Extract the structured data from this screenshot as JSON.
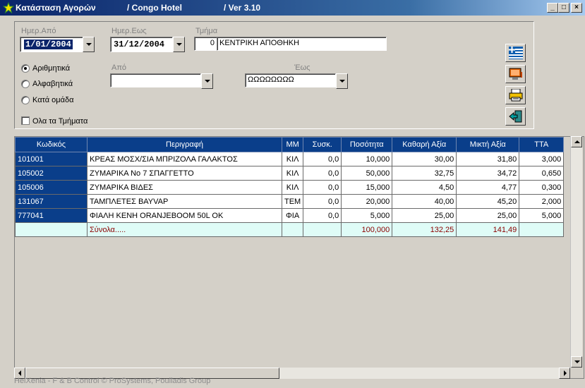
{
  "window": {
    "title": "Κατάσταση Αγορών",
    "hotel": "/ Congo Hotel",
    "version": "/ Ver  3.10",
    "minimize": "_",
    "maximize": "□",
    "close": "×"
  },
  "filters": {
    "date_from_label": "Ημερ.Από",
    "date_from_value": "1/01/2004",
    "date_to_label": "Ημερ.Εως",
    "date_to_value": "31/12/2004",
    "department_label": "Τμήμα",
    "department_code": "0",
    "department_name": "ΚΕΝΤΡΙΚΗ ΑΠΟΘΗΚΗ",
    "from_label": "Από",
    "from_value": "",
    "to_label": "Έως",
    "to_value": "ΩΩΩΩΩΩΩΩ"
  },
  "sort_options": [
    {
      "label": "Αριθμητικά",
      "selected": true
    },
    {
      "label": "Αλφαβητικά",
      "selected": false
    },
    {
      "label": "Κατά ομάδα",
      "selected": false
    }
  ],
  "all_departments": {
    "label": "Ολα τα Τμήματα",
    "checked": false
  },
  "toolbar": [
    {
      "name": "language-flag",
      "icon": "greek-flag-icon"
    },
    {
      "name": "screen-preview",
      "icon": "monitor-icon"
    },
    {
      "name": "print",
      "icon": "printer-icon"
    },
    {
      "name": "exit",
      "icon": "exit-door-icon"
    }
  ],
  "table": {
    "columns": [
      "Κωδικός",
      "Περιγραφή",
      "ΜΜ",
      "Συσκ.",
      "Ποσότητα",
      "Καθαρή Αξία",
      "Μικτή Αξία",
      "ΤΤΑ"
    ],
    "rows": [
      [
        "101001",
        "ΚΡΕΑΣ ΜΟΣΧ/ΣΙΑ ΜΠΡΙΖΟΛΑ ΓΑΛΑΚΤΟΣ",
        "ΚΙΛ",
        "0,0",
        "10,000",
        "30,00",
        "31,80",
        "3,000"
      ],
      [
        "105002",
        "ΖΥΜΑΡΙΚΑ Νο 7 ΣΠΑΓΓΕΤΤΟ",
        "ΚΙΛ",
        "0,0",
        "50,000",
        "32,75",
        "34,72",
        "0,650"
      ],
      [
        "105006",
        "ΖΥΜΑΡΙΚΑ ΒΙΔΕΣ",
        "ΚΙΛ",
        "0,0",
        "15,000",
        "4,50",
        "4,77",
        "0,300"
      ],
      [
        "131067",
        "ΤΑΜΠΛΕΤΕΣ ΒΑΥVAP",
        "ΤΕΜ",
        "0,0",
        "20,000",
        "40,00",
        "45,20",
        "2,000"
      ],
      [
        "777041",
        "ΦΙΑΛΗ ΚΕΝΗ ORANJEBOOM 50L OK",
        "ΦΙΑ",
        "0,0",
        "5,000",
        "25,00",
        "25,00",
        "5,000"
      ]
    ],
    "totals": [
      "",
      "Σύνολα.....",
      "",
      "",
      "100,000",
      "132,25",
      "141,49",
      ""
    ]
  },
  "footer": "HelXenia - F & B Control  © ProSystems,  Poulladis Group",
  "colors": {
    "title_bar": "#0a246a",
    "grid_header": "#0a3e8a",
    "total_row": "#dffcf7",
    "total_text": "#8b0000"
  }
}
